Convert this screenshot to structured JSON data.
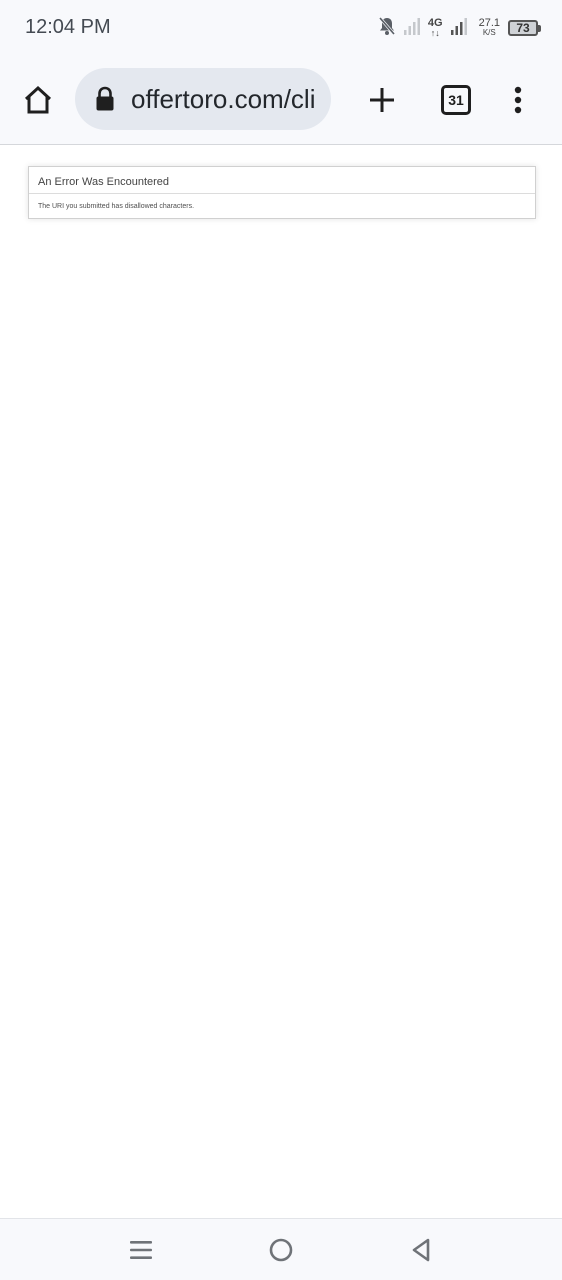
{
  "status_bar": {
    "time": "12:04 PM",
    "network_type": "4G",
    "network_arrows": "↑↓",
    "speed_value": "27.1",
    "speed_unit": "K/S",
    "battery_level": "73",
    "icons": [
      "bell-muted-icon",
      "signal-icon",
      "signal-icon",
      "battery-icon"
    ]
  },
  "toolbar": {
    "url": "offertoro.com/cli",
    "tab_count": "31",
    "icons": [
      "home-icon",
      "lock-icon",
      "plus-icon",
      "tabs-icon",
      "more-vert-icon"
    ]
  },
  "page": {
    "error_title": "An Error Was Encountered",
    "error_message": "The URI you submitted has disallowed characters."
  },
  "nav_bar": {
    "icons": [
      "recents-icon",
      "home-circle-icon",
      "back-icon"
    ]
  }
}
